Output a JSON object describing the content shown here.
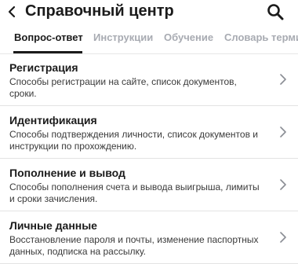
{
  "header": {
    "title": "Справочный центр",
    "back_icon": "chevron-left-icon",
    "search_icon": "search-icon"
  },
  "tabs": [
    {
      "label": "Вопрос-ответ",
      "active": true
    },
    {
      "label": "Инструкции",
      "active": false
    },
    {
      "label": "Обучение",
      "active": false
    },
    {
      "label": "Словарь терми",
      "active": false
    }
  ],
  "items": [
    {
      "title": "Регистрация",
      "description": "Способы регистрации на сайте, список документов, сроки."
    },
    {
      "title": "Идентификация",
      "description": "Способы подтверждения личности, список документов и инструкции по прохождению."
    },
    {
      "title": "Пополнение и вывод",
      "description": "Способы пополнения счета и вывода выигрыша, лимиты и сроки зачисления."
    },
    {
      "title": "Личные данные",
      "description": "Восстановление пароля и почты, изменение паспортных данных, подписка на рассылку."
    }
  ],
  "colors": {
    "text": "#1b1b1b",
    "tab_inactive": "#a8abb2",
    "divider": "#e3e3e3"
  }
}
